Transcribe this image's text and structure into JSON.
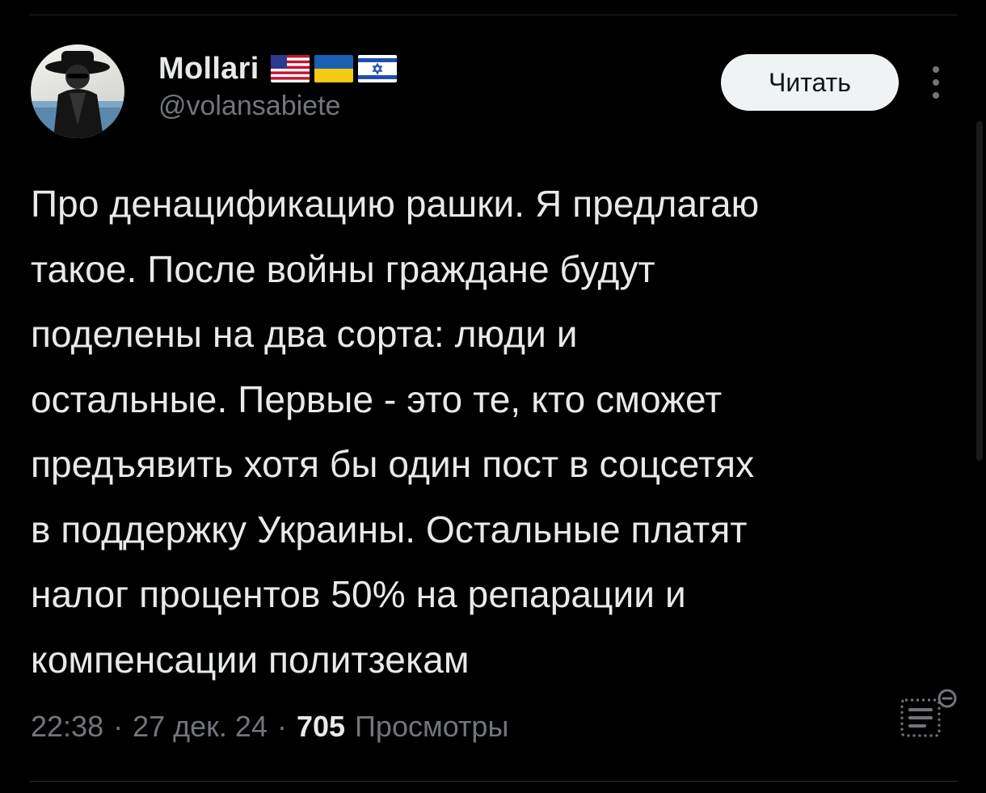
{
  "author": {
    "name": "Mollari",
    "handle": "@volansabiete",
    "flags": [
      "us-flag",
      "ukraine-flag",
      "israel-flag"
    ]
  },
  "follow_button": {
    "label": "Читать"
  },
  "tweet": {
    "text": "Про денацификацию рашки. Я предлагаю\nтакое. После войны граждане будут\nподелены на два сорта: люди и\nостальные. Первые - это те, кто сможет\nпредъявить хотя бы один пост в соцсетях\nв поддержку Украины. Остальные платят\nналог процентов 50% на репарации и\nкомпенсации политзекам",
    "time": "22:38",
    "separator": "·",
    "date": "27 дек. 24",
    "views_count": "705",
    "views_label": "Просмотры"
  },
  "icons": {
    "more": "more-vertical-icon",
    "analytics": "post-analytics-icon"
  },
  "colors": {
    "background": "#000000",
    "text": "#e7e9ea",
    "secondary": "#71767b",
    "button_bg": "#eff3f4"
  }
}
